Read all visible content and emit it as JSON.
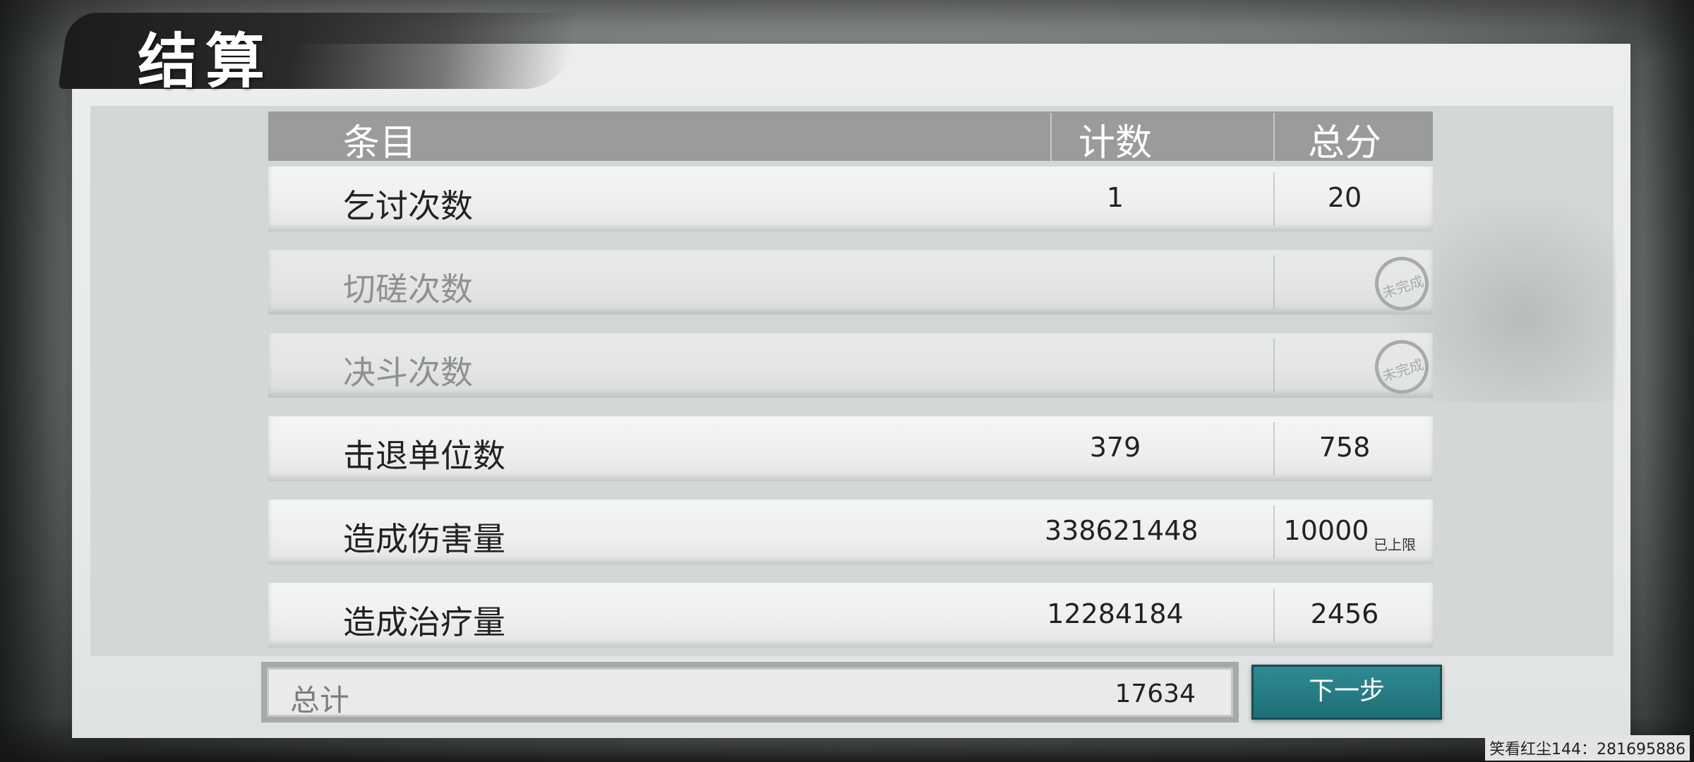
{
  "title": "结算",
  "table": {
    "headers": {
      "item": "条目",
      "count": "计数",
      "score": "总分"
    },
    "rows": [
      {
        "label": "乞讨次数",
        "count": "1",
        "score": "20",
        "cap_note": "",
        "completed": true
      },
      {
        "label": "切磋次数",
        "count": "",
        "score": "",
        "cap_note": "",
        "completed": false,
        "stamp": "未完成"
      },
      {
        "label": "决斗次数",
        "count": "",
        "score": "",
        "cap_note": "",
        "completed": false,
        "stamp": "未完成"
      },
      {
        "label": "击退单位数",
        "count": "379",
        "score": "758",
        "cap_note": "",
        "completed": true
      },
      {
        "label": "造成伤害量",
        "count": "338621448",
        "score": "10000",
        "cap_note": "已上限",
        "completed": true
      },
      {
        "label": "造成治疗量",
        "count": "12284184",
        "score": "2456",
        "cap_note": "",
        "completed": true
      }
    ]
  },
  "total": {
    "label": "总计",
    "value": "17634"
  },
  "next_button": {
    "label": "下一步"
  },
  "footer": {
    "text": "笑看红尘144：281695886"
  },
  "colors": {
    "accent": "#2f8a92",
    "header_bg": "#9a9b9b",
    "title_brush": "#1c1c1c"
  },
  "icons": {
    "incomplete_stamp": "incomplete-stamp-icon"
  }
}
